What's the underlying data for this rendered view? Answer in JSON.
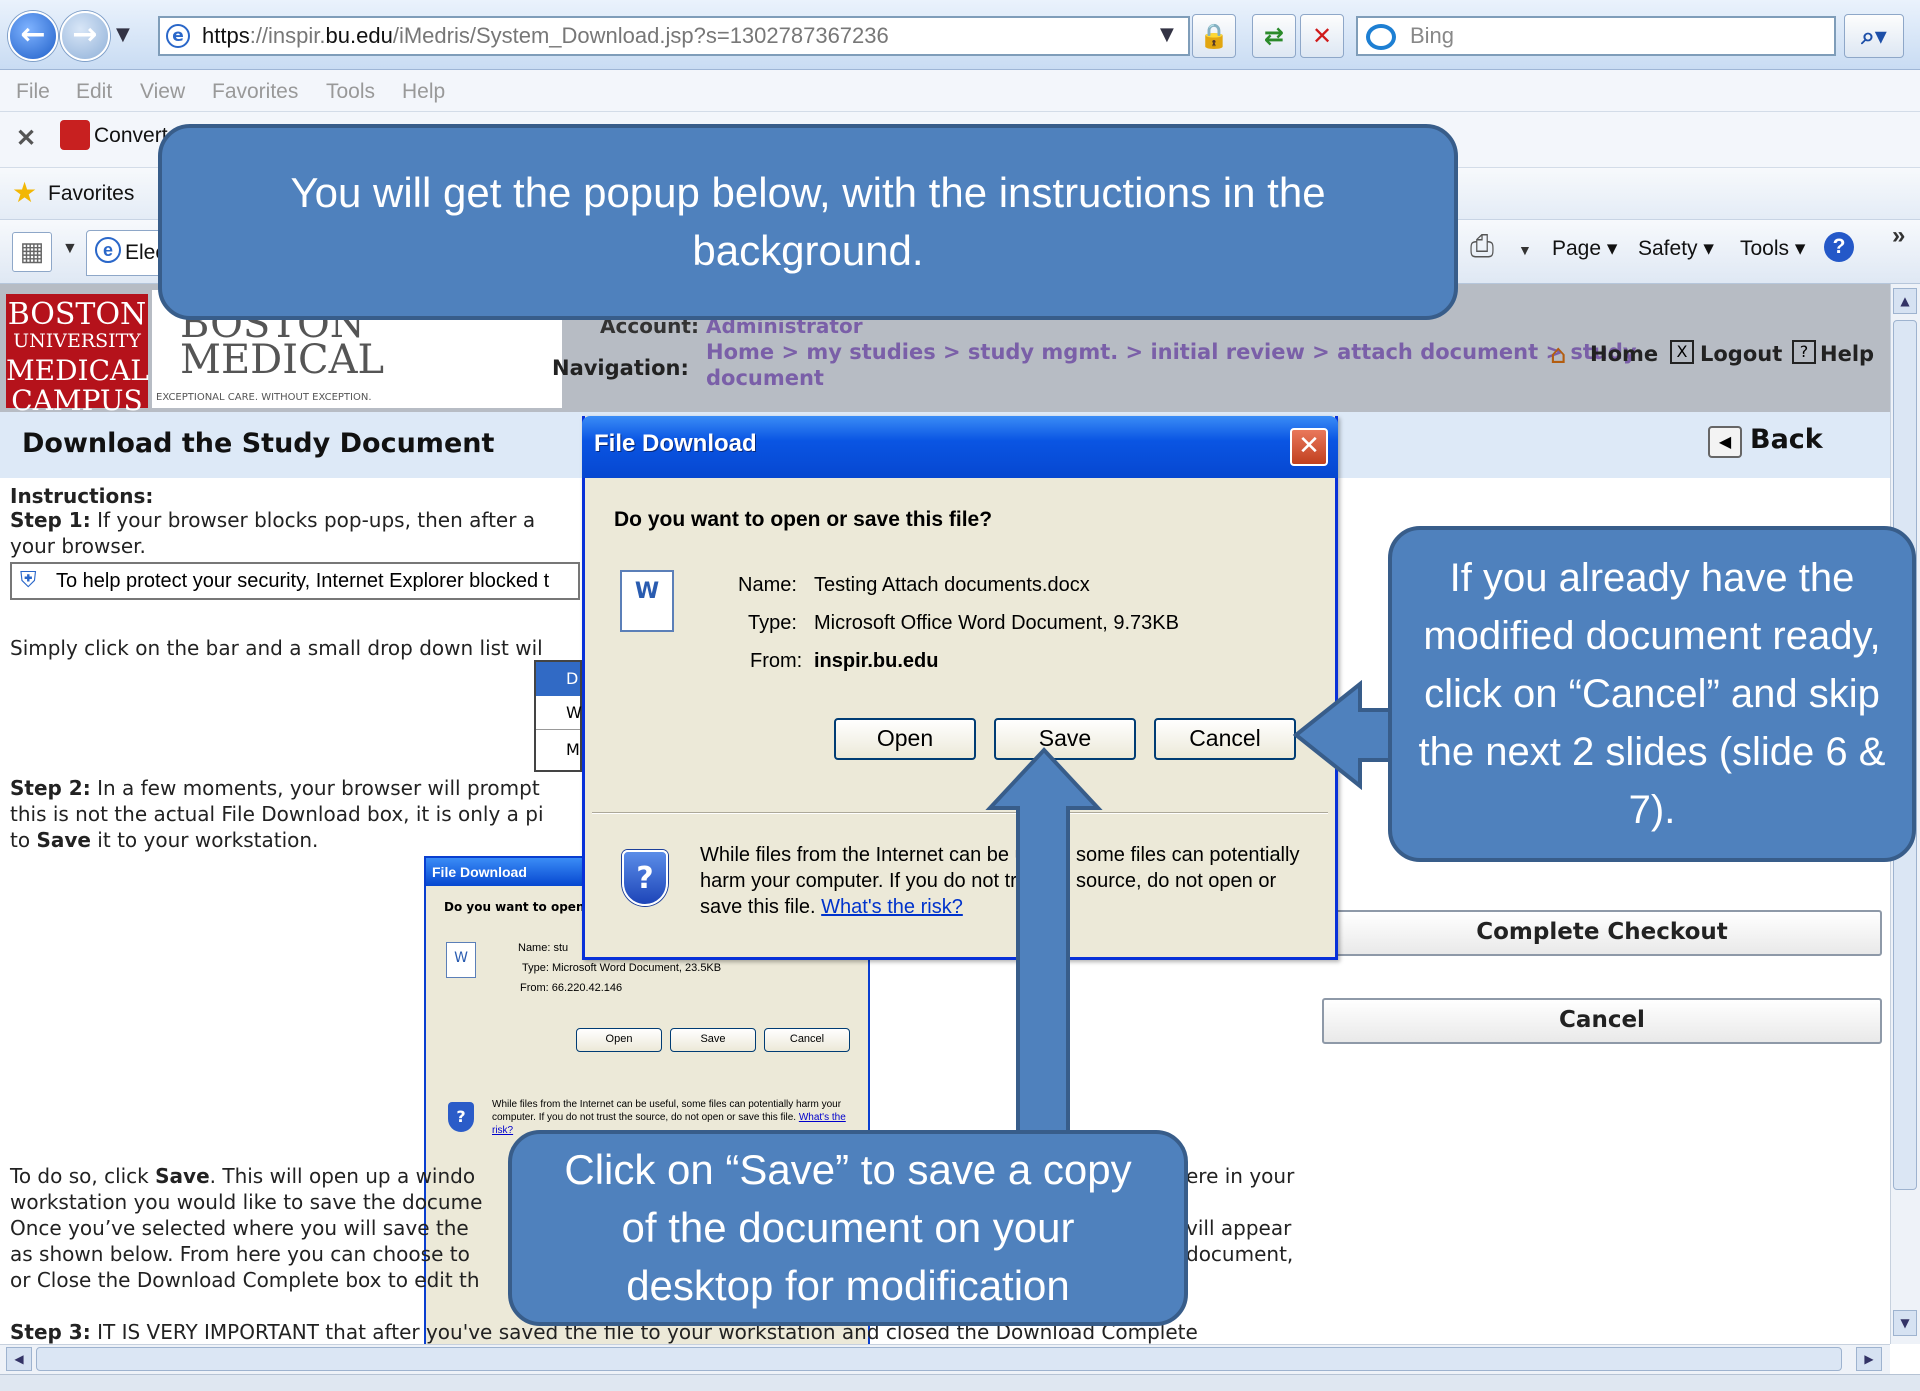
{
  "browser": {
    "url_secure": "https",
    "url_sep": "://",
    "url_grey_prefix": "inspir.",
    "url_host_bold": "bu.edu",
    "url_rest": "/iMedris/System_Download.jsp?s=1302787367236",
    "search_placeholder": "Bing",
    "menu": [
      "File",
      "Edit",
      "View",
      "Favorites",
      "Tools",
      "Help"
    ],
    "convert_label": "Convert",
    "favorites_label": "Favorites",
    "tab_label": "Elec",
    "cmd": {
      "page": "Page",
      "safety": "Safety",
      "tools": "Tools"
    }
  },
  "site": {
    "bu_logo": [
      "BOSTON",
      "UNIVERSITY",
      "MEDICAL",
      "CAMPUS"
    ],
    "bmc_logo": [
      "BOSTON",
      "MEDICAL"
    ],
    "bmc_tagline": "EXCEPTIONAL CARE. WITHOUT EXCEPTION.",
    "account_label": "Account:",
    "account_value": "Administrator",
    "navigation_label": "Navigation:",
    "navigation_path_1": "Home > my studies > study mgmt. > initial review > attach document > study",
    "navigation_path_2": "document",
    "home": "Home",
    "logout": "Logout",
    "help": "Help"
  },
  "page": {
    "title": "Download the Study Document",
    "back": "Back",
    "instructions_heading": "Instructions:",
    "step1_label": "Step 1:",
    "step1_text": " If your browser blocks pop-ups, then after a",
    "step1_cont": "your browser.",
    "infobar_text": "To help protect your security, Internet Explorer blocked t",
    "simply_text": "Simply click on the bar and a small drop down list wil",
    "dropdown_letters": [
      "D",
      "W",
      "M"
    ],
    "step2_label": "Step 2:",
    "step2_text": " In a few moments, your browser will prompt",
    "step2_l2": "this is not the actual File Download box, it is only a pi",
    "step2_l3_a": "to ",
    "step2_l3_b": "Save",
    "step2_l3_c": " it to your workstation.",
    "todo_a": "To do so, click ",
    "todo_b": "Save",
    "todo_c": ". This will open up a windo",
    "todo_right": "ere in your",
    "l2": "workstation you would like to save the docume",
    "l3": "Once you’ve selected where you will save the",
    "l3_right": "vill appear",
    "l4": "as shown below. From here you can choose to",
    "l4_right": "document,",
    "l5": "or Close the Download Complete box to edit th",
    "step3_label": "Step 3:",
    "step3_text": " IT IS VERY IMPORTANT that after you've saved the file to your workstation and closed the Download Complete",
    "complete_checkout": "Complete Checkout",
    "cancel": "Cancel"
  },
  "mini_dialog": {
    "title": "File Download",
    "question": "Do you want to open",
    "name_label": "Name:",
    "name_value": "stu",
    "type_label": "Type:",
    "type_value": "Microsoft Word Document, 23.5KB",
    "from_label": "From:",
    "from_value": "66.220.42.146",
    "open": "Open",
    "save": "Save",
    "cancel": "Cancel",
    "warning": "While files from the Internet can be useful, some files can potentially harm your computer. If you do not trust the source, do not open or save this file.",
    "risk": "What's the risk?"
  },
  "dialog": {
    "title": "File Download",
    "question": "Do you want to open or save this file?",
    "name_label": "Name:",
    "name_value": "Testing Attach documents.docx",
    "type_label": "Type:",
    "type_value": "Microsoft Office Word Document, 9.73KB",
    "from_label": "From:",
    "from_value": "inspir.bu.edu",
    "open": "Open",
    "save": "Save",
    "cancel": "Cancel",
    "warning_1a": "While files from the Internet can be u",
    "warning_1b": "some files can potentially",
    "warning_2a": "harm your computer. If you do not tr",
    "warning_2b": "source, do not open or",
    "warning_3": "save this file.",
    "risk": "What's the risk?"
  },
  "callouts": {
    "top": "You will get the popup below, with the instructions in the background.",
    "right": "If you already have the modified document ready, click on “Cancel” and skip the next 2 slides (slide 6 & 7).",
    "bottom": "Click on “Save” to save a copy of the document on your desktop for modification"
  },
  "colors": {
    "callout": "#4f81bd",
    "callout_border": "#385d8a",
    "xp_title": "#0a55e3",
    "link": "#7a5fa8"
  }
}
